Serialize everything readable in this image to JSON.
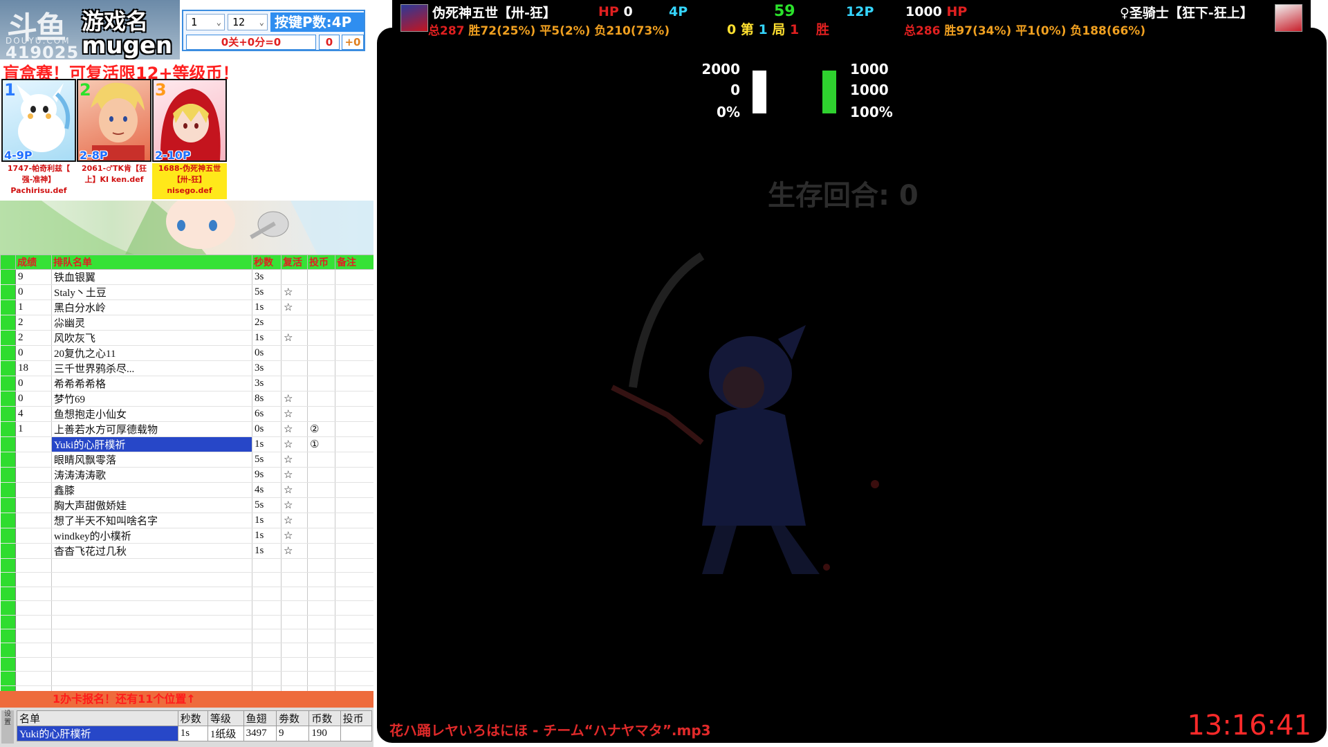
{
  "left_panel": {
    "logo": {
      "text": "斗鱼",
      "site": "DOUYU.COM",
      "room_id": "419025"
    },
    "game_label": "游戏名",
    "game_name": "mugen",
    "controls": {
      "select1": "1",
      "select2": "12",
      "players_label": "按键P数:4P",
      "stage_formula": "0关+0分=0",
      "score": "0",
      "bonus": "+0"
    },
    "banner": "盲盒赛！可复活限12+等级币！",
    "cards": [
      {
        "num": "1",
        "level": "4-9P",
        "caption_line1": "1747-帕奇利兹【",
        "caption_line2": "强-准神】",
        "file": "Pachirisu.def",
        "num_color": "#2b7bff"
      },
      {
        "num": "2",
        "level": "2-8P",
        "caption_line1": "2061-♂TK肯【狂",
        "caption_line2": "上】KI ken.def",
        "file": "",
        "num_color": "#2be22b"
      },
      {
        "num": "3",
        "level": "2-10P",
        "caption_line1": "1688-伪死神五世",
        "caption_line2": "【卅-狂】",
        "file": "nisego.def",
        "num_color": "#ff9a1a"
      }
    ],
    "queue": {
      "headers": [
        "成绩",
        "排队名单",
        "秒数",
        "复活",
        "投币",
        "备注"
      ],
      "rows": [
        {
          "score": "9",
          "name": "铁血银翼",
          "sec": "3s",
          "revive": "",
          "coin": ""
        },
        {
          "score": "0",
          "name": "Staly丶土豆",
          "sec": "5s",
          "revive": "☆",
          "coin": ""
        },
        {
          "score": "1",
          "name": "黑白分水岭",
          "sec": "1s",
          "revive": "☆",
          "coin": ""
        },
        {
          "score": "2",
          "name": "尛幽灵",
          "sec": "2s",
          "revive": "",
          "coin": ""
        },
        {
          "score": "2",
          "name": "风吹灰飞",
          "sec": "1s",
          "revive": "☆",
          "coin": ""
        },
        {
          "score": "0",
          "name": "20复仇之心11",
          "sec": "0s",
          "revive": "",
          "coin": ""
        },
        {
          "score": "18",
          "name": "三千世界鸦杀尽...",
          "sec": "3s",
          "revive": "",
          "coin": ""
        },
        {
          "score": "0",
          "name": "希希希希格",
          "sec": "3s",
          "revive": "",
          "coin": ""
        },
        {
          "score": "0",
          "name": "梦竹69",
          "sec": "8s",
          "revive": "☆",
          "coin": ""
        },
        {
          "score": "4",
          "name": "鱼想抱走小仙女",
          "sec": "6s",
          "revive": "☆",
          "coin": ""
        },
        {
          "score": "1",
          "name": "上善若水方可厚德载物",
          "sec": "0s",
          "revive": "☆",
          "coin": "②"
        },
        {
          "score": "",
          "name": "Yuki的心肝樸祈",
          "sec": "1s",
          "revive": "☆",
          "coin": "①"
        },
        {
          "score": "",
          "name": "眼睛风飘零落",
          "sec": "5s",
          "revive": "☆",
          "coin": ""
        },
        {
          "score": "",
          "name": "涛涛涛涛歌",
          "sec": "9s",
          "revive": "☆",
          "coin": ""
        },
        {
          "score": "",
          "name": "鑫膝",
          "sec": "4s",
          "revive": "☆",
          "coin": ""
        },
        {
          "score": "",
          "name": "胸大声甜傲娇娃",
          "sec": "5s",
          "revive": "☆",
          "coin": ""
        },
        {
          "score": "",
          "name": "想了半天不知叫啥名字",
          "sec": "1s",
          "revive": "☆",
          "coin": ""
        },
        {
          "score": "",
          "name": "windkey的小樸祈",
          "sec": "1s",
          "revive": "☆",
          "coin": ""
        },
        {
          "score": "",
          "name": "杳杳飞花过几秋",
          "sec": "1s",
          "revive": "☆",
          "coin": ""
        }
      ],
      "empty_rows": 11,
      "selected_index": 11
    },
    "signup_text": "1办卡报名！还有11个位置↑",
    "bottom": {
      "side_text": "设置",
      "headers": [
        "名单",
        "秒数",
        "等级",
        "鱼翅",
        "劵数",
        "币数",
        "投币"
      ],
      "row": [
        "Yuki的心肝樸祈",
        "1s",
        "1纸级",
        "3497",
        "9",
        "190",
        ""
      ]
    }
  },
  "game": {
    "top": {
      "p1_name": "伪死神五世【卅-狂】",
      "p1_hp_label": "HP",
      "p1_hp": "0",
      "p1_players": "4P",
      "timer": "59",
      "p2_players": "12P",
      "p2_hp": "1000",
      "p2_hp_label": "HP",
      "p2_name": "♀圣骑士【狂下-狂上】",
      "p1_stats": [
        "总287",
        "胜72(25%)",
        "平5(2%)",
        "负210(73%)"
      ],
      "round_prefix": "0 第",
      "round_num": "1",
      "round_suffix": "局",
      "round_val": "1",
      "round_win": "胜",
      "p2_stats": [
        "总286",
        "胜97(34%)",
        "平1(0%)",
        "负188(66%)"
      ]
    },
    "stats_left": [
      "2000",
      "0",
      "0%"
    ],
    "stats_right": [
      "1000",
      "1000",
      "100%"
    ],
    "bars": {
      "left_color": "#ffffff",
      "right_color": "#2fd12f"
    },
    "survive_text": "生存回合: 0",
    "song": "花ハ踊レヤいろはにほ - チーム“ハナヤマタ”.mp3",
    "clock": "13:16:41"
  },
  "colors": {
    "accent_green": "#36e236",
    "accent_red": "#e02020",
    "selected_blue": "#2747c8",
    "control_blue": "#2f8ef0"
  }
}
